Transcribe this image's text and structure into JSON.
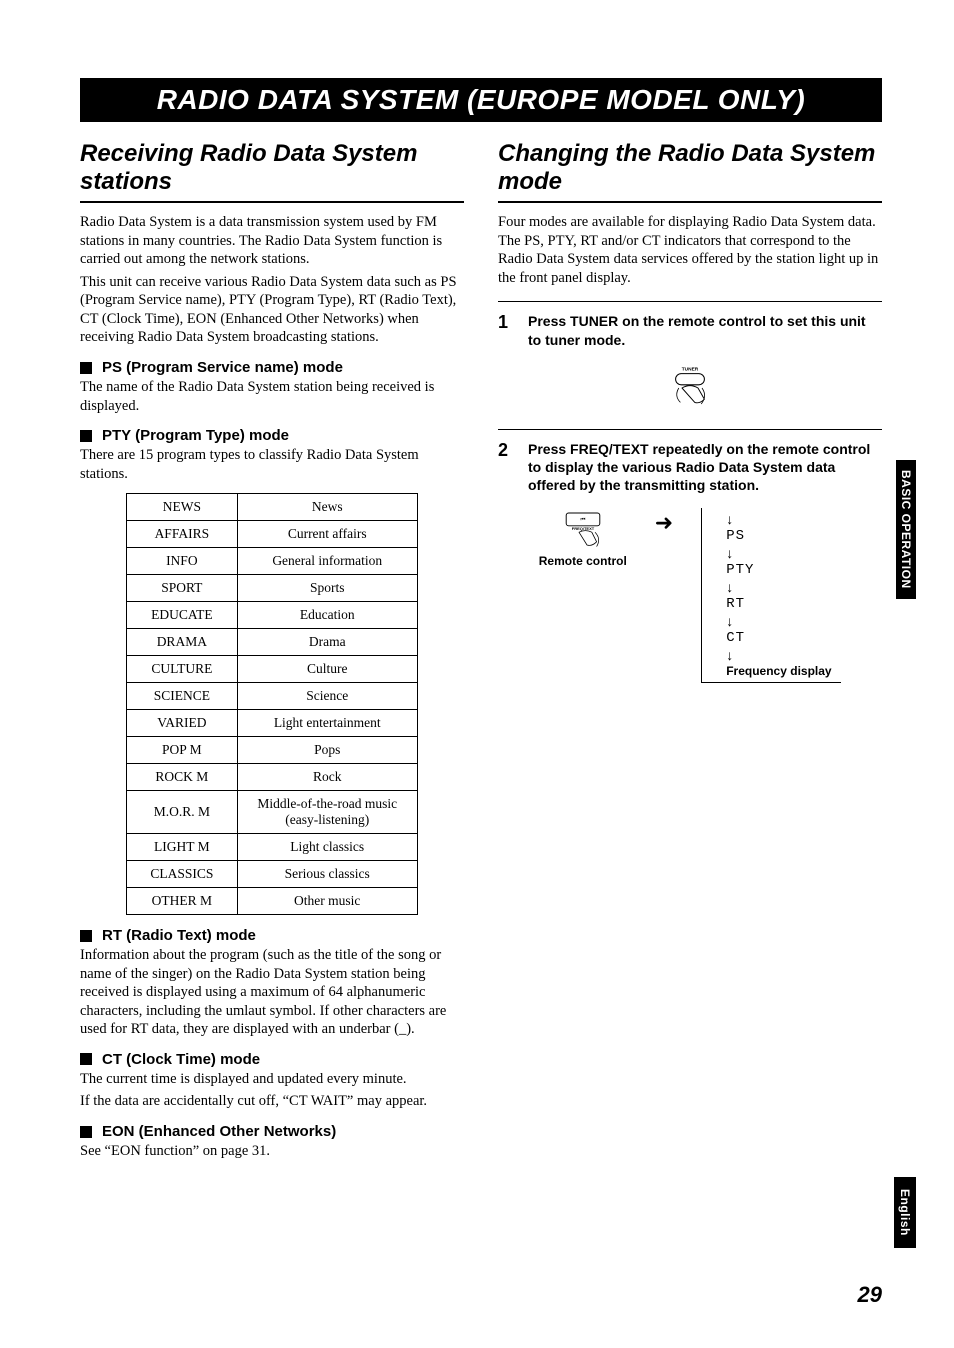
{
  "banner": "RADIO DATA SYSTEM (EUROPE MODEL ONLY)",
  "left": {
    "title": "Receiving Radio Data System stations",
    "intro1": "Radio Data System is a data transmission system used by FM stations in many countries. The Radio Data System function is carried out among the network stations.",
    "intro2": "This unit can receive various Radio Data System data such as PS (Program Service name), PTY (Program Type), RT (Radio Text), CT (Clock Time), EON (Enhanced Other Networks) when receiving Radio Data System broadcasting stations.",
    "ps_heading": "PS (Program Service name) mode",
    "ps_body": "The name of the Radio Data System station being received is displayed.",
    "pty_heading": "PTY (Program Type) mode",
    "pty_body": "There are 15 program types to classify Radio Data System stations.",
    "pty_table": [
      {
        "code": "NEWS",
        "desc": "News"
      },
      {
        "code": "AFFAIRS",
        "desc": "Current affairs"
      },
      {
        "code": "INFO",
        "desc": "General information"
      },
      {
        "code": "SPORT",
        "desc": "Sports"
      },
      {
        "code": "EDUCATE",
        "desc": "Education"
      },
      {
        "code": "DRAMA",
        "desc": "Drama"
      },
      {
        "code": "CULTURE",
        "desc": "Culture"
      },
      {
        "code": "SCIENCE",
        "desc": "Science"
      },
      {
        "code": "VARIED",
        "desc": "Light entertainment"
      },
      {
        "code": "POP M",
        "desc": "Pops"
      },
      {
        "code": "ROCK M",
        "desc": "Rock"
      },
      {
        "code": "M.O.R. M",
        "desc": "Middle-of-the-road music (easy-listening)"
      },
      {
        "code": "LIGHT M",
        "desc": "Light classics"
      },
      {
        "code": "CLASSICS",
        "desc": "Serious classics"
      },
      {
        "code": "OTHER M",
        "desc": "Other music"
      }
    ],
    "rt_heading": "RT (Radio Text) mode",
    "rt_body": "Information about the program (such as the title of the song or name of the singer) on the Radio Data System station being received is displayed using a maximum of 64 alphanumeric characters, including the umlaut symbol. If other characters are used for RT data, they are displayed with an underbar (_).",
    "ct_heading": "CT (Clock Time) mode",
    "ct_body1": "The current time is displayed and updated every minute.",
    "ct_body2": "If the data are accidentally cut off, “CT WAIT” may appear.",
    "eon_heading": "EON (Enhanced Other Networks)",
    "eon_body": "See “EON function” on page 31."
  },
  "right": {
    "title": "Changing the Radio Data System mode",
    "intro": "Four modes are available for displaying Radio Data System data. The PS, PTY, RT and/or CT indicators that correspond to the Radio Data System data services offered by the station light up in the front panel display.",
    "step1_num": "1",
    "step1_txt": "Press TUNER on the remote control to set this unit to tuner mode.",
    "step1_button": "TUNER",
    "step2_num": "2",
    "step2_txt": "Press FREQ/TEXT repeatedly on the remote control to display the various Radio Data System data offered by the transmitting station.",
    "step2_button": "FREQ/TEXT",
    "remote_label": "Remote control",
    "flow": [
      "PS",
      "PTY",
      "RT",
      "CT"
    ],
    "flow_end": "Frequency display"
  },
  "side_tab": "BASIC OPERATION",
  "english_tab": "English",
  "page_number": "29"
}
